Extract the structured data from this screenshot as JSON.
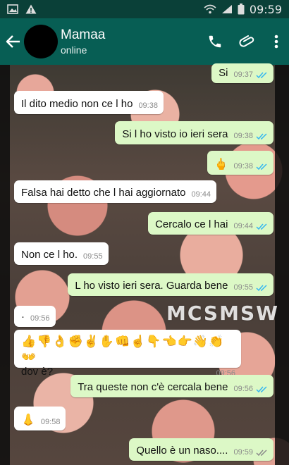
{
  "status_bar": {
    "time": "09:59"
  },
  "header": {
    "contact_name": "Mamaa",
    "contact_status": "online"
  },
  "icons": {
    "back": "arrow-left",
    "call": "phone",
    "attach": "paperclip",
    "menu": "more-vertical"
  },
  "colors": {
    "header": "#075e54",
    "status_bar": "#0a4038",
    "incoming": "#ffffff",
    "outgoing": "#dcf8c6",
    "read_ticks": "#34b7f1"
  },
  "messages": [
    {
      "dir": "out",
      "text": "Si",
      "time": "09:37",
      "status": "read"
    },
    {
      "dir": "in",
      "text": "Il dito medio non ce  l ho",
      "time": "09:38"
    },
    {
      "dir": "out",
      "text": "Si l ho visto io ieri sera",
      "time": "09:38",
      "status": "read"
    },
    {
      "dir": "out",
      "text": "🖕",
      "time": "09:38",
      "status": "read"
    },
    {
      "dir": "in",
      "text": "Falsa hai detto che l hai aggiornato",
      "time": "09:44"
    },
    {
      "dir": "out",
      "text": "Cercalo ce l hai",
      "time": "09:44",
      "status": "read"
    },
    {
      "dir": "in",
      "text": "Non ce  l ho.",
      "time": "09:55"
    },
    {
      "dir": "out",
      "text": "L ho visto ieri sera. Guarda bene",
      "time": "09:55",
      "status": "read"
    },
    {
      "dir": "in",
      "text": "·",
      "time": "09:56"
    },
    {
      "dir": "in",
      "emojis": "👍👎👌✊✌✋👊☝👇👈👉👋👏👐",
      "text": "dov è?",
      "time": "09:56"
    },
    {
      "dir": "out",
      "text": "Tra queste non c'è cercala bene",
      "time": "09:56",
      "status": "read"
    },
    {
      "dir": "in",
      "text": "👃",
      "time": "09:58"
    },
    {
      "dir": "out",
      "text": "Quello è un naso....",
      "time": "09:59",
      "status": "delivered"
    }
  ],
  "watermark": "MCSMSW"
}
